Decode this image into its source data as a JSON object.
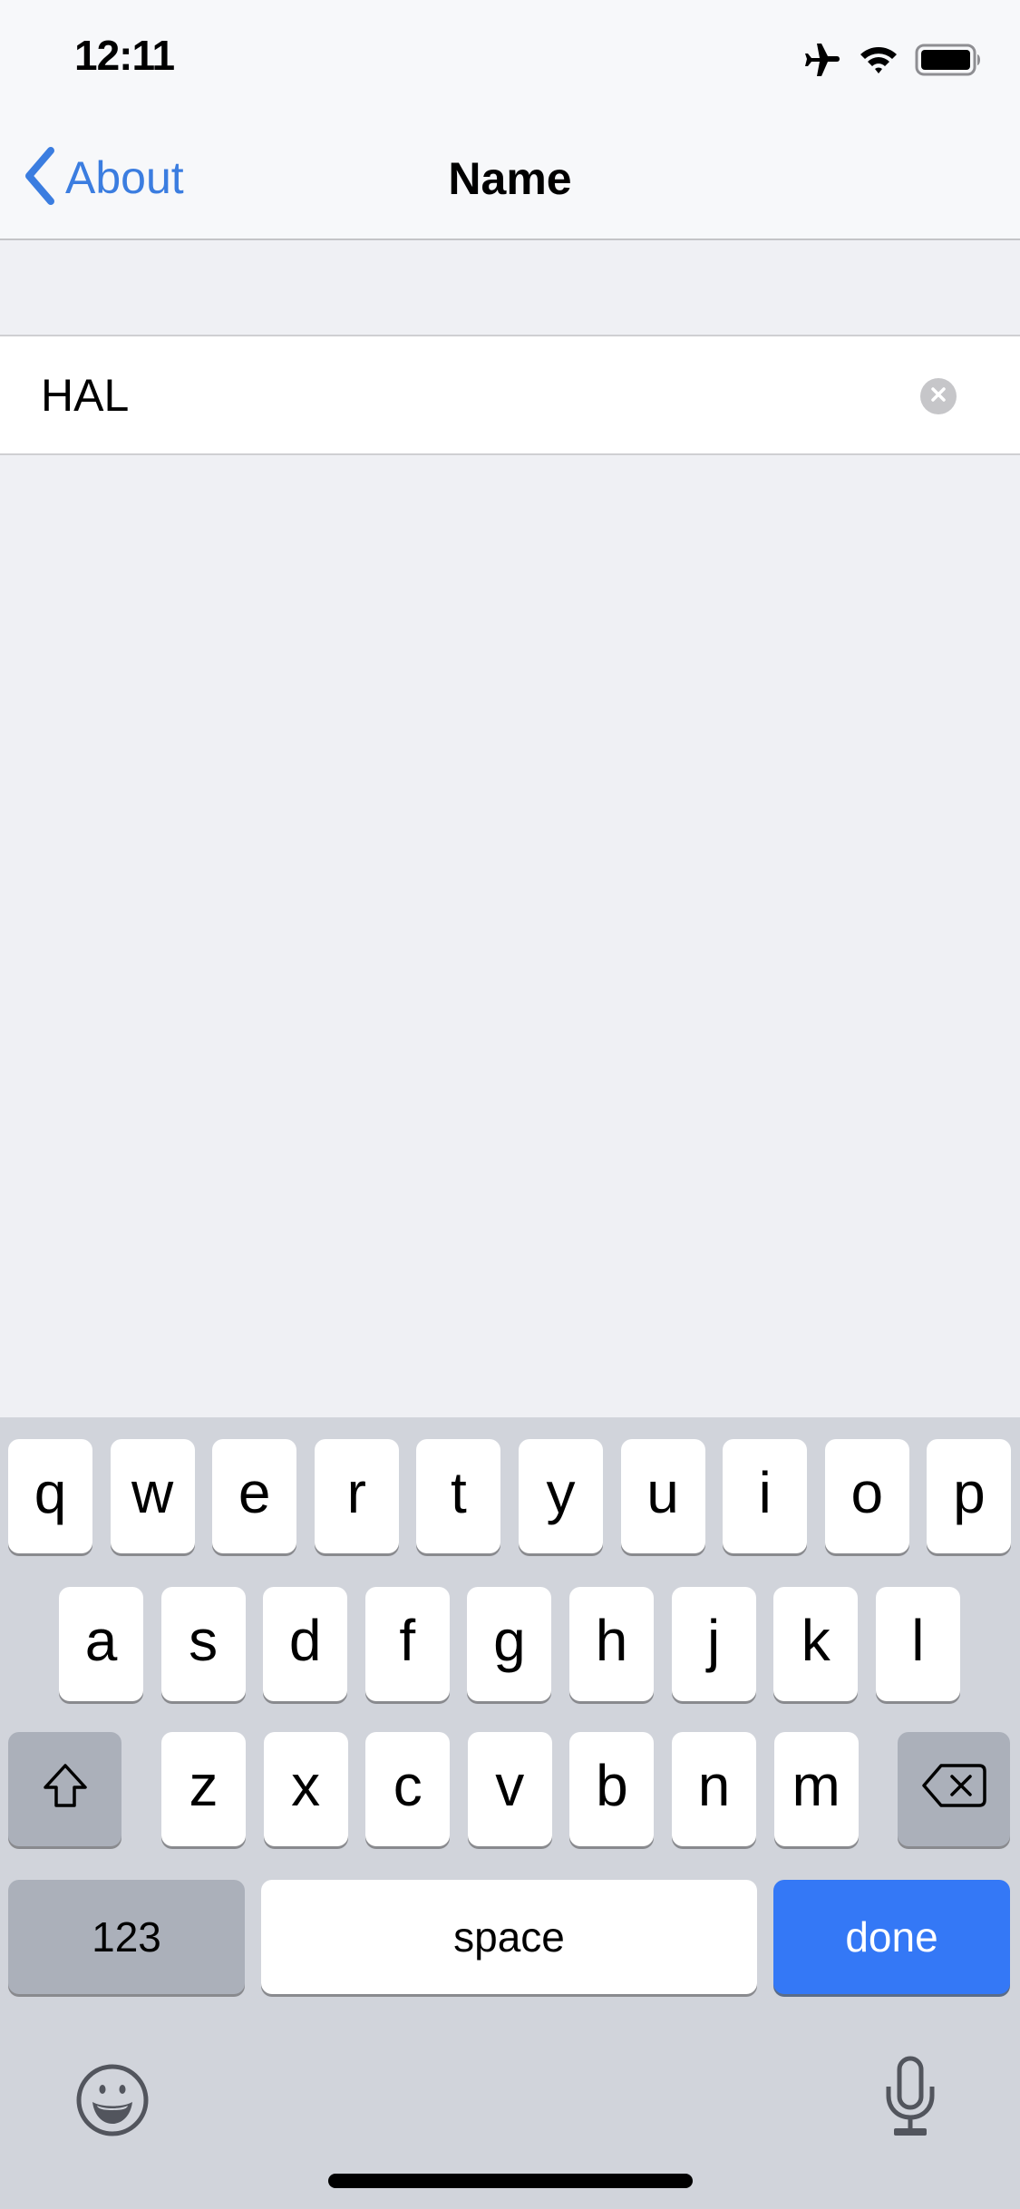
{
  "status_bar": {
    "time": "12:11",
    "icons": [
      "airplane-mode-icon",
      "wifi-icon",
      "battery-icon"
    ]
  },
  "nav": {
    "back_label": "About",
    "back_icon": "chevron-left-icon",
    "title": "Name"
  },
  "name_field": {
    "value": "HAL",
    "clear_icon": "clear-circle-icon"
  },
  "keyboard": {
    "row1": [
      "q",
      "w",
      "e",
      "r",
      "t",
      "y",
      "u",
      "i",
      "o",
      "p"
    ],
    "row2": [
      "a",
      "s",
      "d",
      "f",
      "g",
      "h",
      "j",
      "k",
      "l"
    ],
    "row3": [
      "z",
      "x",
      "c",
      "v",
      "b",
      "n",
      "m"
    ],
    "shift_icon": "shift-icon",
    "delete_icon": "backspace-icon",
    "numbers_label": "123",
    "space_label": "space",
    "done_label": "done",
    "emoji_icon": "emoji-icon",
    "dictation_icon": "microphone-icon"
  },
  "colors": {
    "accent": "#3b7de0",
    "done_key": "#3478f6",
    "keyboard_bg": "#d1d4db",
    "function_key": "#abb0ba",
    "page_bg": "#eff0f4"
  }
}
